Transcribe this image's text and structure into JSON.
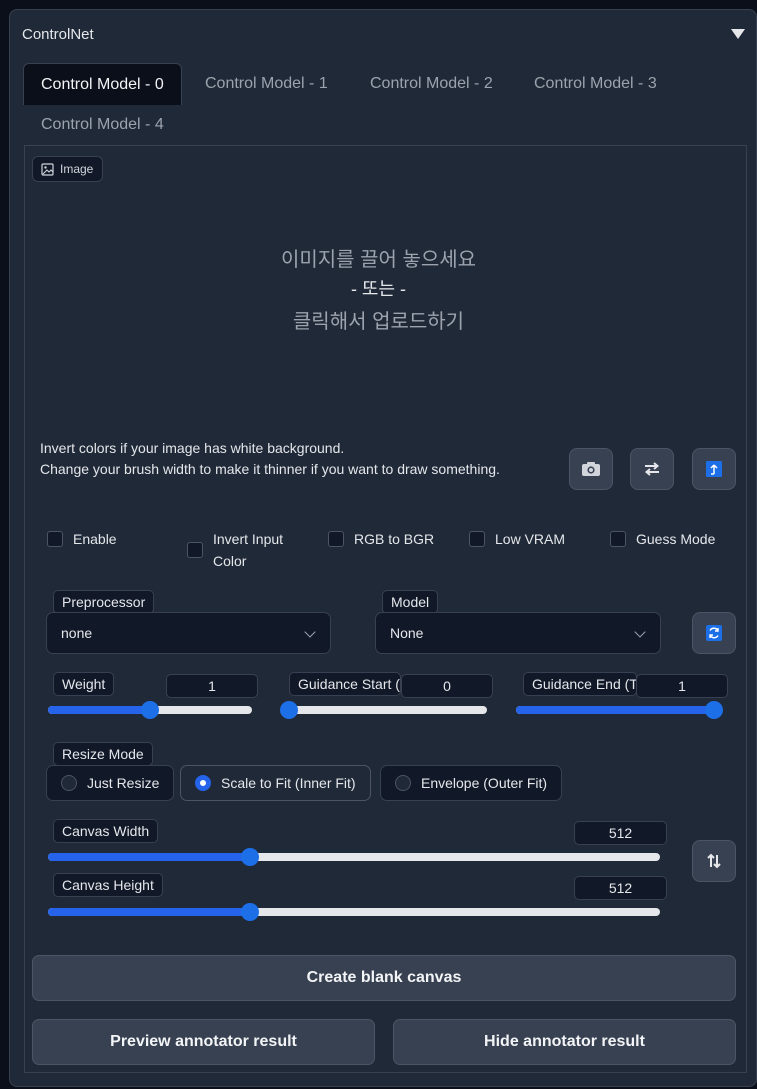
{
  "colors": {
    "accent": "#2563eb",
    "panel": "#1f2937",
    "input_bg": "#111827",
    "border": "#374151",
    "text": "#e5e7eb",
    "muted": "#9ca3af"
  },
  "accordion": {
    "title": "ControlNet",
    "toggle_icon": "triangle-down-icon"
  },
  "tabs": [
    "Control Model - 0",
    "Control Model - 1",
    "Control Model - 2",
    "Control Model - 3",
    "Control Model - 4"
  ],
  "active_tab": 0,
  "image": {
    "label": "Image",
    "drop_line1": "이미지를 끌어 놓으세요",
    "drop_line2": "- 또는 -",
    "drop_line3": "클릭해서 업로드하기"
  },
  "hints": {
    "line1": "Invert colors if your image has white background.",
    "line2": "Change your brush width to make it thinner if you want to draw something."
  },
  "icon_buttons": [
    "camera-icon",
    "swap-icon",
    "send-icon"
  ],
  "checkboxes": {
    "enable": "Enable",
    "invert_line1": "Invert Input",
    "invert_line2": "Color",
    "rgb_to_bgr": "RGB to BGR",
    "low_vram": "Low VRAM",
    "guess_mode": "Guess Mode"
  },
  "preprocessor": {
    "label": "Preprocessor",
    "value": "none"
  },
  "model": {
    "label": "Model",
    "value": "None"
  },
  "weight": {
    "label": "Weight",
    "value": "1",
    "fraction": 0.5
  },
  "guidance_start": {
    "label": "Guidance Start (T)",
    "value": "0",
    "fraction": 0.0
  },
  "guidance_end": {
    "label": "Guidance End (T)",
    "value": "1",
    "fraction": 1.0
  },
  "resize_mode": {
    "label": "Resize Mode",
    "options": [
      "Just Resize",
      "Scale to Fit (Inner Fit)",
      "Envelope (Outer Fit)"
    ],
    "selected": 1
  },
  "canvas_width": {
    "label": "Canvas Width",
    "value": "512",
    "fraction": 0.33
  },
  "canvas_height": {
    "label": "Canvas Height",
    "value": "512",
    "fraction": 0.33
  },
  "buttons": {
    "create_canvas": "Create blank canvas",
    "preview": "Preview annotator result",
    "hide": "Hide annotator result"
  }
}
